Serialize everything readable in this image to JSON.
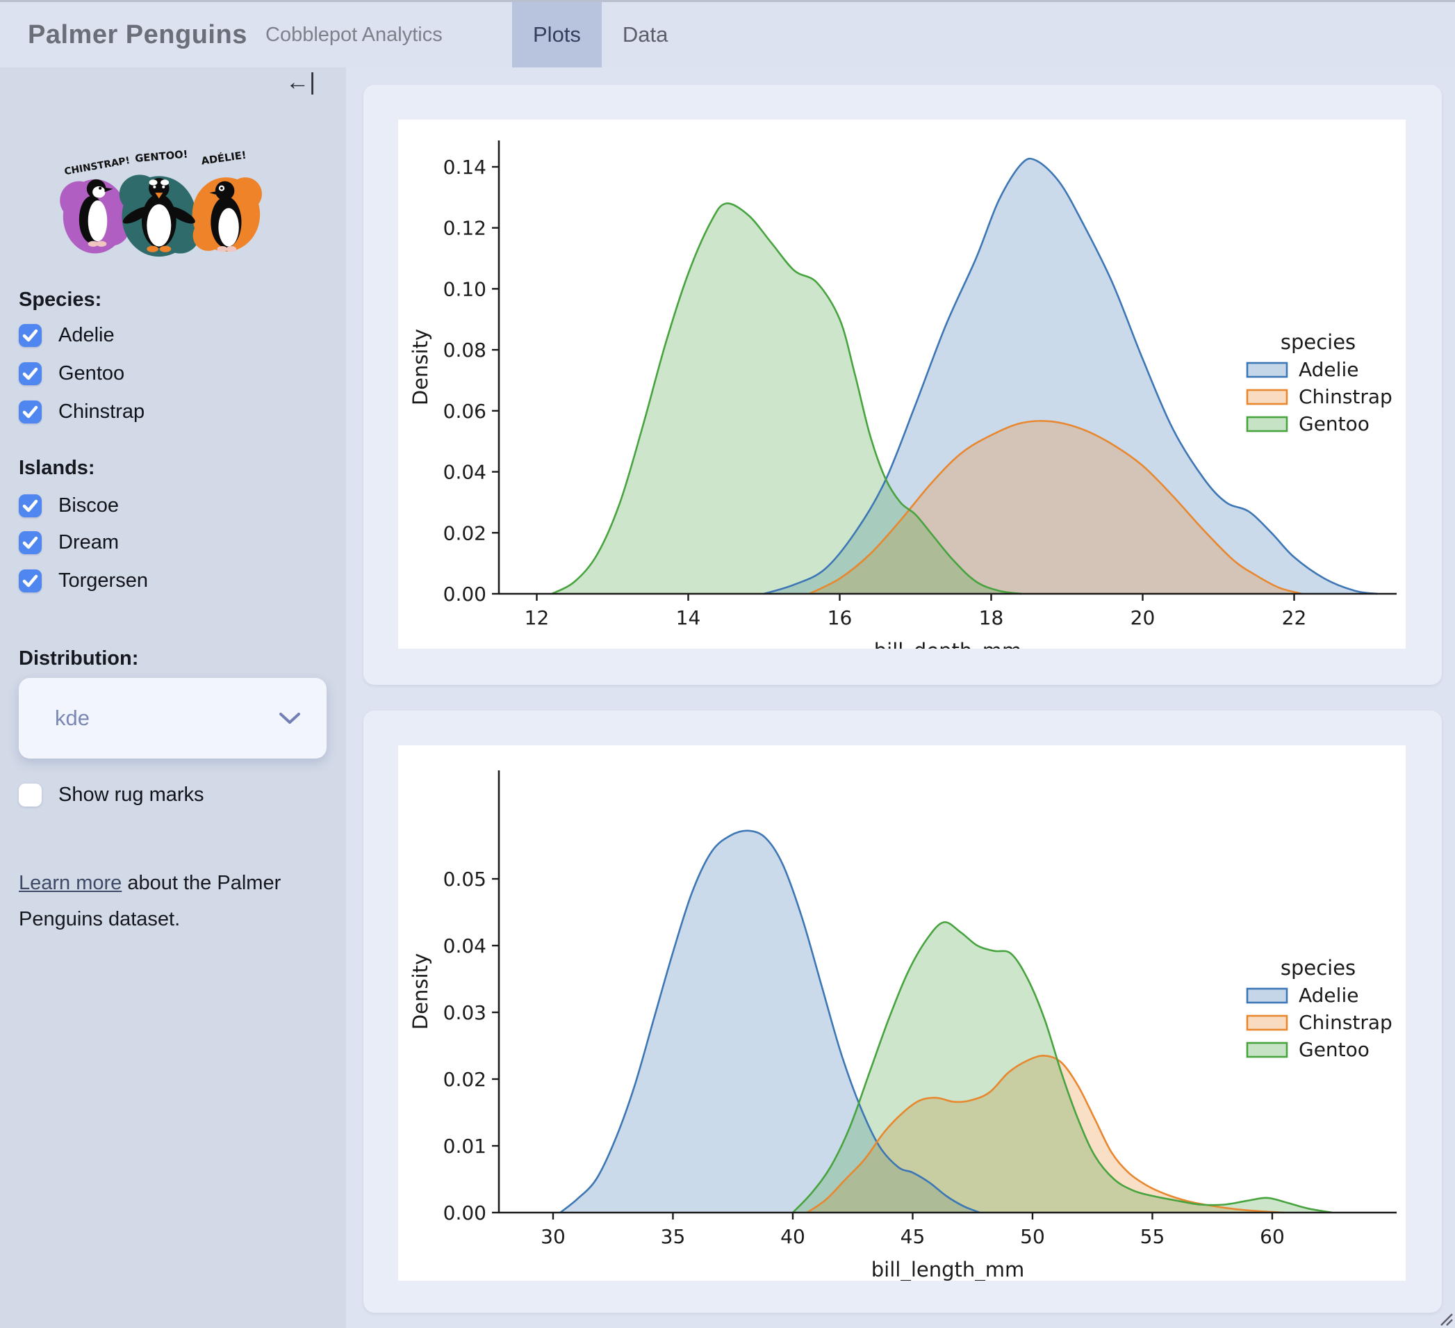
{
  "header": {
    "title": "Palmer Penguins",
    "subtitle": "Cobblepot Analytics",
    "tabs": [
      {
        "label": "Plots",
        "active": true
      },
      {
        "label": "Data",
        "active": false
      }
    ]
  },
  "sidebar": {
    "collapse_icon": "←|",
    "artwork_labels": [
      "CHINSTRAP!",
      "GENTOO!",
      "ADÉLIE!"
    ],
    "species": {
      "heading": "Species:",
      "items": [
        {
          "label": "Adelie",
          "checked": true
        },
        {
          "label": "Gentoo",
          "checked": true
        },
        {
          "label": "Chinstrap",
          "checked": true
        }
      ]
    },
    "islands": {
      "heading": "Islands:",
      "items": [
        {
          "label": "Biscoe",
          "checked": true
        },
        {
          "label": "Dream",
          "checked": true
        },
        {
          "label": "Torgersen",
          "checked": true
        }
      ]
    },
    "distribution": {
      "heading": "Distribution:",
      "value": "kde"
    },
    "rug": {
      "label": "Show rug marks",
      "checked": false
    },
    "learn_more": {
      "link_text": "Learn more",
      "rest_text": " about the Palmer Penguins dataset."
    }
  },
  "colors": {
    "accent_blue": "#4f86f0",
    "active_tab_bg": "#b8c4de",
    "adelie": "#3d76b4",
    "chinstrap": "#e8872e",
    "gentoo": "#47a33e",
    "artwork_purple": "#b15ec2",
    "artwork_teal": "#2f6b6b",
    "artwork_orange": "#ef8329"
  },
  "chart_data": [
    {
      "type": "area",
      "subtype": "kde",
      "title": "",
      "xlabel": "bill_depth_mm",
      "ylabel": "Density",
      "xlim": [
        11.5,
        23.35
      ],
      "ylim": [
        0,
        0.149
      ],
      "xticks": [
        12,
        14,
        16,
        18,
        20,
        22
      ],
      "yticks": [
        0.0,
        0.02,
        0.04,
        0.06,
        0.08,
        0.1,
        0.12,
        0.14
      ],
      "grid": false,
      "legend": {
        "title": "species",
        "position": "right",
        "entries": [
          "Adelie",
          "Chinstrap",
          "Gentoo"
        ]
      },
      "series": [
        {
          "name": "Adelie",
          "color": "adelie",
          "points": [
            [
              15.0,
              0
            ],
            [
              15.4,
              0.003
            ],
            [
              15.8,
              0.008
            ],
            [
              16.2,
              0.02
            ],
            [
              16.6,
              0.037
            ],
            [
              17.0,
              0.062
            ],
            [
              17.4,
              0.088
            ],
            [
              17.8,
              0.11
            ],
            [
              18.1,
              0.129
            ],
            [
              18.4,
              0.141
            ],
            [
              18.6,
              0.142
            ],
            [
              18.9,
              0.135
            ],
            [
              19.2,
              0.122
            ],
            [
              19.6,
              0.102
            ],
            [
              20.0,
              0.077
            ],
            [
              20.4,
              0.054
            ],
            [
              20.8,
              0.038
            ],
            [
              21.1,
              0.03
            ],
            [
              21.4,
              0.027
            ],
            [
              21.7,
              0.02
            ],
            [
              22.0,
              0.012
            ],
            [
              22.4,
              0.005
            ],
            [
              22.8,
              0.001
            ],
            [
              23.1,
              0
            ]
          ]
        },
        {
          "name": "Chinstrap",
          "color": "chinstrap",
          "points": [
            [
              15.6,
              0
            ],
            [
              16.0,
              0.005
            ],
            [
              16.4,
              0.013
            ],
            [
              16.8,
              0.024
            ],
            [
              17.2,
              0.036
            ],
            [
              17.6,
              0.046
            ],
            [
              18.0,
              0.052
            ],
            [
              18.4,
              0.056
            ],
            [
              18.8,
              0.0565
            ],
            [
              19.2,
              0.054
            ],
            [
              19.6,
              0.049
            ],
            [
              20.0,
              0.042
            ],
            [
              20.4,
              0.032
            ],
            [
              20.8,
              0.021
            ],
            [
              21.2,
              0.011
            ],
            [
              21.5,
              0.006
            ],
            [
              21.8,
              0.002
            ],
            [
              22.1,
              0
            ]
          ]
        },
        {
          "name": "Gentoo",
          "color": "gentoo",
          "points": [
            [
              12.2,
              0
            ],
            [
              12.5,
              0.004
            ],
            [
              12.8,
              0.013
            ],
            [
              13.1,
              0.03
            ],
            [
              13.4,
              0.055
            ],
            [
              13.7,
              0.082
            ],
            [
              14.0,
              0.105
            ],
            [
              14.3,
              0.122
            ],
            [
              14.5,
              0.128
            ],
            [
              14.8,
              0.124
            ],
            [
              15.1,
              0.115
            ],
            [
              15.4,
              0.106
            ],
            [
              15.7,
              0.102
            ],
            [
              16.0,
              0.09
            ],
            [
              16.2,
              0.072
            ],
            [
              16.4,
              0.052
            ],
            [
              16.6,
              0.038
            ],
            [
              16.8,
              0.03
            ],
            [
              17.0,
              0.026
            ],
            [
              17.2,
              0.02
            ],
            [
              17.5,
              0.011
            ],
            [
              17.8,
              0.004
            ],
            [
              18.1,
              0.001
            ],
            [
              18.4,
              0
            ]
          ]
        }
      ]
    },
    {
      "type": "area",
      "subtype": "kde",
      "title": "",
      "xlabel": "bill_length_mm",
      "ylabel": "Density",
      "xlim": [
        27.74,
        65.0
      ],
      "ylim": [
        0,
        0.066
      ],
      "xticks": [
        30,
        35,
        40,
        45,
        50,
        55,
        60
      ],
      "yticks": [
        0.0,
        0.01,
        0.02,
        0.03,
        0.04,
        0.05
      ],
      "grid": false,
      "legend": {
        "title": "species",
        "position": "right",
        "entries": [
          "Adelie",
          "Chinstrap",
          "Gentoo"
        ]
      },
      "series": [
        {
          "name": "Adelie",
          "color": "adelie",
          "points": [
            [
              30.3,
              0
            ],
            [
              31.0,
              0.002
            ],
            [
              31.8,
              0.005
            ],
            [
              32.6,
              0.011
            ],
            [
              33.4,
              0.019
            ],
            [
              34.2,
              0.029
            ],
            [
              35.0,
              0.039
            ],
            [
              35.8,
              0.048
            ],
            [
              36.6,
              0.054
            ],
            [
              37.4,
              0.0565
            ],
            [
              38.2,
              0.0572
            ],
            [
              38.9,
              0.056
            ],
            [
              39.6,
              0.052
            ],
            [
              40.4,
              0.044
            ],
            [
              41.2,
              0.034
            ],
            [
              42.0,
              0.024
            ],
            [
              42.8,
              0.016
            ],
            [
              43.6,
              0.01
            ],
            [
              44.4,
              0.0068
            ],
            [
              45.0,
              0.006
            ],
            [
              45.7,
              0.0045
            ],
            [
              46.4,
              0.0025
            ],
            [
              47.1,
              0.001
            ],
            [
              47.8,
              0
            ]
          ]
        },
        {
          "name": "Chinstrap",
          "color": "chinstrap",
          "points": [
            [
              40.6,
              0
            ],
            [
              41.4,
              0.002
            ],
            [
              42.2,
              0.005
            ],
            [
              43.0,
              0.008
            ],
            [
              43.8,
              0.012
            ],
            [
              44.6,
              0.015
            ],
            [
              45.3,
              0.0168
            ],
            [
              46.0,
              0.0172
            ],
            [
              46.7,
              0.0166
            ],
            [
              47.4,
              0.0168
            ],
            [
              48.2,
              0.018
            ],
            [
              49.0,
              0.021
            ],
            [
              49.8,
              0.0228
            ],
            [
              50.5,
              0.0235
            ],
            [
              51.2,
              0.0225
            ],
            [
              51.9,
              0.019
            ],
            [
              52.6,
              0.014
            ],
            [
              53.3,
              0.009
            ],
            [
              54.0,
              0.006
            ],
            [
              54.8,
              0.004
            ],
            [
              55.6,
              0.0027
            ],
            [
              56.5,
              0.0017
            ],
            [
              57.5,
              0.001
            ],
            [
              58.5,
              0.0005
            ],
            [
              59.5,
              0.0002
            ],
            [
              60.5,
              0
            ]
          ]
        },
        {
          "name": "Gentoo",
          "color": "gentoo",
          "points": [
            [
              40.0,
              0
            ],
            [
              40.8,
              0.003
            ],
            [
              41.6,
              0.007
            ],
            [
              42.4,
              0.013
            ],
            [
              43.2,
              0.021
            ],
            [
              44.0,
              0.029
            ],
            [
              44.8,
              0.036
            ],
            [
              45.6,
              0.041
            ],
            [
              46.3,
              0.0435
            ],
            [
              47.0,
              0.042
            ],
            [
              47.7,
              0.04
            ],
            [
              48.4,
              0.0392
            ],
            [
              49.1,
              0.0388
            ],
            [
              49.8,
              0.035
            ],
            [
              50.5,
              0.029
            ],
            [
              51.2,
              0.021
            ],
            [
              51.9,
              0.014
            ],
            [
              52.6,
              0.0085
            ],
            [
              53.4,
              0.005
            ],
            [
              54.2,
              0.0033
            ],
            [
              55.0,
              0.0025
            ],
            [
              56.0,
              0.0018
            ],
            [
              57.0,
              0.0012
            ],
            [
              58.0,
              0.0012
            ],
            [
              59.0,
              0.0018
            ],
            [
              59.8,
              0.0022
            ],
            [
              60.6,
              0.0015
            ],
            [
              61.5,
              0.0006
            ],
            [
              62.5,
              0
            ]
          ]
        }
      ]
    }
  ]
}
